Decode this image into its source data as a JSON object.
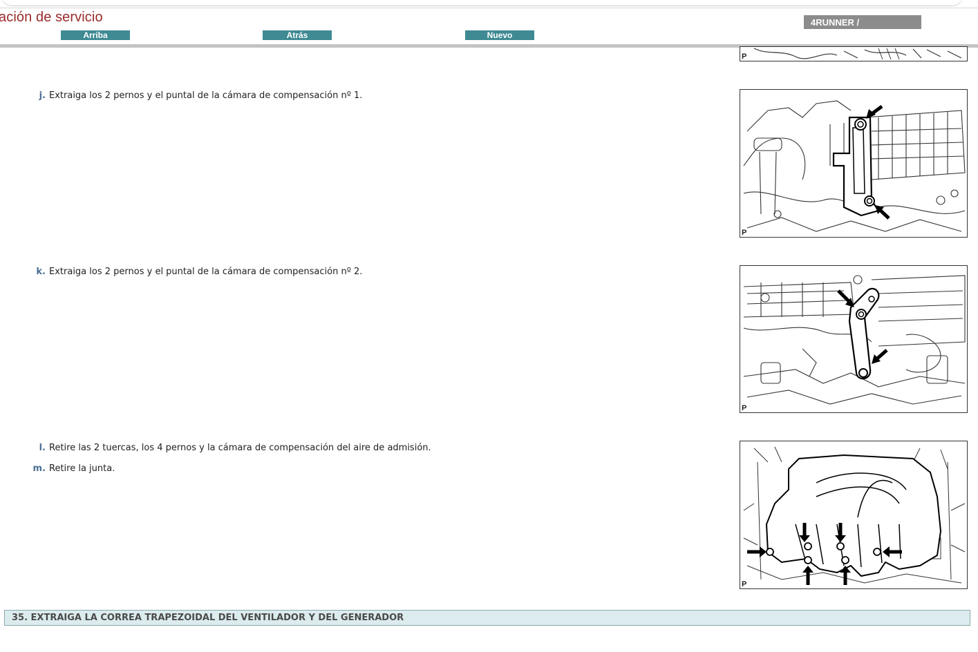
{
  "header": {
    "title": "ación de servicio",
    "buttons": {
      "up": "Arriba",
      "back": "Atrás",
      "new": "Nuevo"
    },
    "model_badge": "4RUNNER /"
  },
  "steps": [
    {
      "letter": "j.",
      "text": "Extraiga los 2 pernos y el puntal de la cámara de compensación nº 1."
    },
    {
      "letter": "k.",
      "text": "Extraiga los 2 pernos y el puntal de la cámara de compensación nº 2."
    },
    {
      "letter": "l.",
      "text": "Retire las 2 tuercas, los 4 pernos y la cámara de compensación del aire de admisión."
    },
    {
      "letter": "m.",
      "text": "Retire la junta."
    }
  ],
  "figures": {
    "label": "P"
  },
  "section": {
    "title": "35. EXTRAIGA LA CORREA TRAPEZOIDAL DEL VENTILADOR Y DEL GENERADOR"
  },
  "colors": {
    "title_red": "#9b2a2a",
    "button_teal": "#3f8a93",
    "badge_gray": "#8c8c8c",
    "step_letter_blue": "#4b6f93",
    "section_bg": "#dcecee"
  }
}
